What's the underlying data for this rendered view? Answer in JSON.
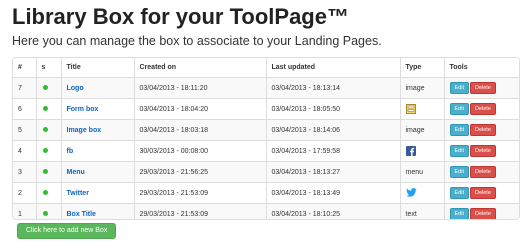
{
  "header": {
    "title": "Library Box for your ToolPage™",
    "subtitle": "Here you can manage the box to associate to your Landing Pages."
  },
  "table": {
    "columns": [
      "#",
      "s",
      "Title",
      "Created on",
      "Last updated",
      "Type",
      "Tools"
    ],
    "edit_label": "Edit",
    "delete_label": "Delete",
    "rows": [
      {
        "id": "7",
        "status": "active",
        "title": "Logo",
        "created": "03/04/2013 - 18:11:20",
        "updated": "03/04/2013 - 18:13:14",
        "type": "image",
        "type_icon": ""
      },
      {
        "id": "6",
        "status": "active",
        "title": "Form box",
        "created": "03/04/2013 - 18:04:20",
        "updated": "03/04/2013 - 18:05:50",
        "type": "",
        "type_icon": "form-icon"
      },
      {
        "id": "5",
        "status": "active",
        "title": "Image box",
        "created": "03/04/2013 - 18:03:18",
        "updated": "03/04/2013 - 18:14:06",
        "type": "image",
        "type_icon": ""
      },
      {
        "id": "4",
        "status": "active",
        "title": "fb",
        "created": "30/03/2013 - 00:08:00",
        "updated": "03/04/2013 - 17:59:58",
        "type": "",
        "type_icon": "facebook-icon"
      },
      {
        "id": "3",
        "status": "active",
        "title": "Menu",
        "created": "29/03/2013 - 21:56:25",
        "updated": "03/04/2013 - 18:13:27",
        "type": "menu",
        "type_icon": ""
      },
      {
        "id": "2",
        "status": "active",
        "title": "Twitter",
        "created": "29/03/2013 - 21:53:09",
        "updated": "03/04/2013 - 18:13:49",
        "type": "",
        "type_icon": "twitter-icon"
      },
      {
        "id": "1",
        "status": "active",
        "title": "Box Title",
        "created": "29/03/2013 - 21:53:09",
        "updated": "03/04/2013 - 18:10:25",
        "type": "text",
        "type_icon": ""
      }
    ]
  },
  "add_button": {
    "label": "Click here to add new Box"
  },
  "colors": {
    "status_active": "#2fbf2f",
    "link": "#0a66c2",
    "edit": "#49afcd",
    "delete": "#da4f49",
    "add": "#5bb75b"
  }
}
